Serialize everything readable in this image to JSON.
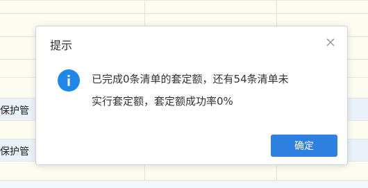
{
  "background": {
    "row_labels": [
      "保护管",
      "保护管"
    ]
  },
  "dialog": {
    "title": "提示",
    "close_icon": "close-icon",
    "info_icon": "info-icon",
    "message_line1": "已完成0条清单的套定额，还有54条清单未",
    "message_line2": "实行套定额，套定额成功率0%",
    "confirm_label": "确定"
  },
  "colors": {
    "accent": "#2d80e0",
    "info": "#1e87e8"
  }
}
